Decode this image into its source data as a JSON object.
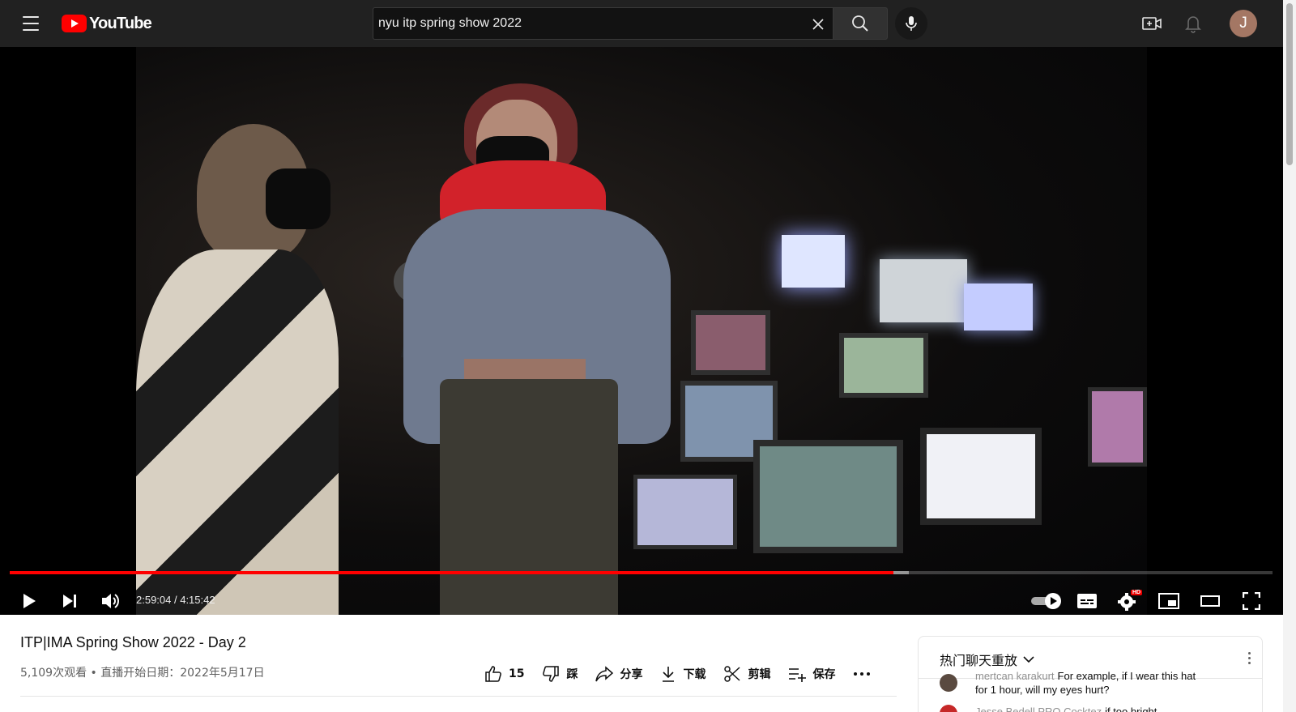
{
  "header": {
    "logo_text": "YouTube",
    "search": {
      "value": "nyu itp spring show 2022",
      "placeholder": "搜索"
    },
    "avatar_initial": "J"
  },
  "player": {
    "current_time": "2:59:04",
    "duration": "4:15:42",
    "time_display": "2:59:04 / 4:15:42",
    "progress_played_fraction": 0.7,
    "progress_buffered_fraction": 0.712,
    "settings_badge": "HD",
    "autoplay_on": true
  },
  "video": {
    "title": "ITP|IMA Spring Show 2022 - Day 2",
    "meta": "5,109次观看 • 直播开始日期：2022年5月17日"
  },
  "actions": {
    "like_count": "15",
    "dislike_label": "踩",
    "share_label": "分享",
    "download_label": "下载",
    "clip_label": "剪辑",
    "save_label": "保存"
  },
  "chat": {
    "header_title": "热门聊天重放",
    "messages": [
      {
        "author": "mertcan karakurt",
        "text_line1": "For example, if I wear this hat",
        "text_line2": "for 1 hour, will my eyes hurt?"
      },
      {
        "author": "Jesse Bedell PRO Cocktez",
        "text_line1": "if too bright"
      }
    ]
  },
  "colors": {
    "topbar": "#212121",
    "accent_red": "#ff0000",
    "avatar_bg": "#a47764"
  }
}
